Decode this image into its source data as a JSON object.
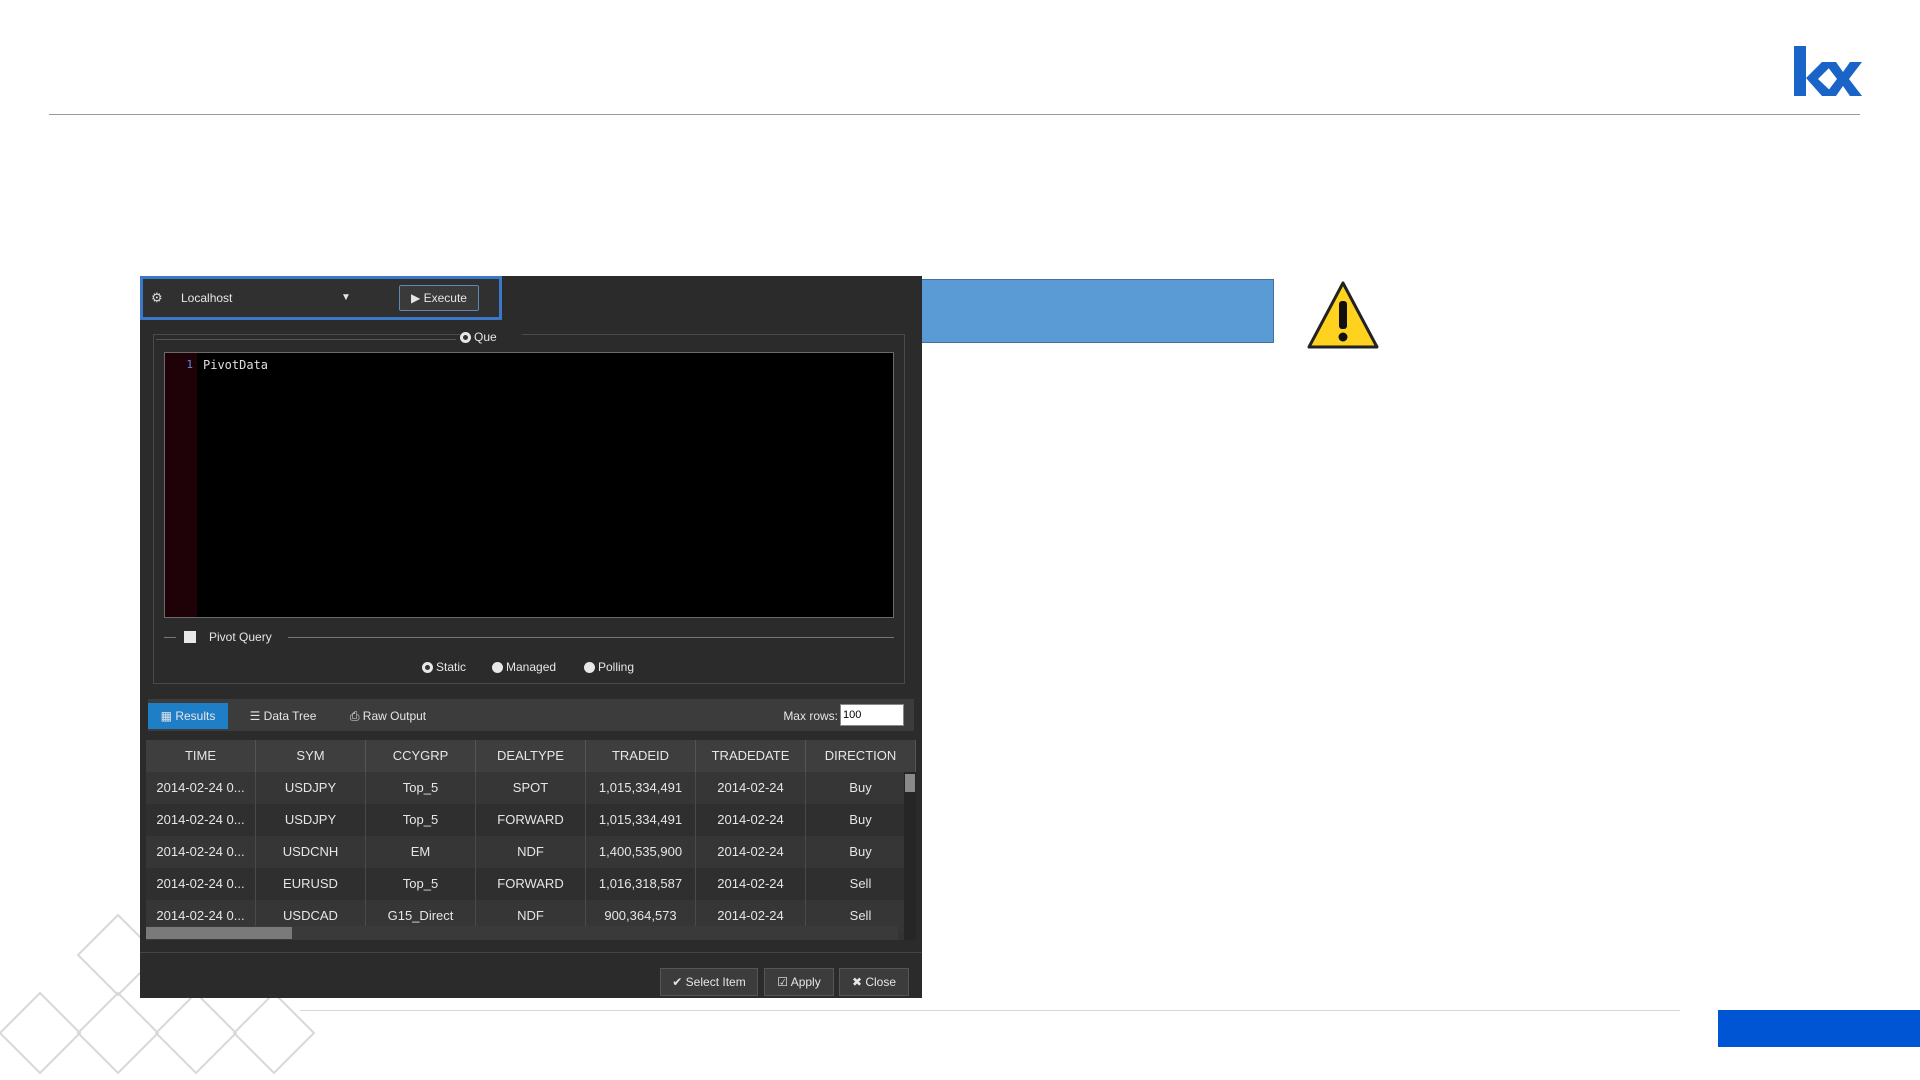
{
  "toolbar": {
    "connection_name": "Localhost",
    "execute_label": "▶ Execute",
    "conn_icon": "⚙"
  },
  "query": {
    "radio_label": "Que",
    "line_number": "1",
    "code": "PivotData",
    "pivot_label": "Pivot Query",
    "modes": {
      "static": "Static",
      "managed": "Managed",
      "polling": "Polling"
    }
  },
  "tabs": {
    "results": "▦ Results",
    "data_tree": "☰ Data Tree",
    "raw_output": "⎙ Raw Output",
    "max_rows_label": "Max rows:",
    "max_rows_value": "100"
  },
  "grid": {
    "columns": [
      "TIME",
      "SYM",
      "CCYGRP",
      "DEALTYPE",
      "TRADEID",
      "TRADEDATE",
      "DIRECTION"
    ],
    "rows": [
      [
        "2014-02-24 0...",
        "USDJPY",
        "Top_5",
        "SPOT",
        "1,015,334,491",
        "2014-02-24",
        "Buy"
      ],
      [
        "2014-02-24 0...",
        "USDJPY",
        "Top_5",
        "FORWARD",
        "1,015,334,491",
        "2014-02-24",
        "Buy"
      ],
      [
        "2014-02-24 0...",
        "USDCNH",
        "EM",
        "NDF",
        "1,400,535,900",
        "2014-02-24",
        "Buy"
      ],
      [
        "2014-02-24 0...",
        "EURUSD",
        "Top_5",
        "FORWARD",
        "1,016,318,587",
        "2014-02-24",
        "Sell"
      ],
      [
        "2014-02-24 0...",
        "USDCAD",
        "G15_Direct",
        "NDF",
        "900,364,573",
        "2014-02-24",
        "Sell"
      ]
    ]
  },
  "footer": {
    "select_item": "✔ Select Item",
    "apply": "☑ Apply",
    "close": "✖ Close"
  },
  "colors": {
    "callout": "#5b9bd5",
    "accent_blue": "#0055d4",
    "logo": "#1a64c8"
  },
  "icons": [
    "kx-logo",
    "warning-icon",
    "connection-icon",
    "play-icon",
    "check-icon",
    "close-icon"
  ]
}
